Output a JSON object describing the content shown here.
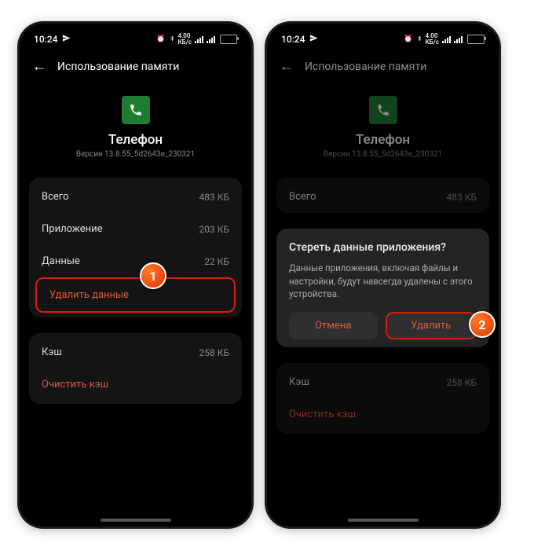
{
  "status": {
    "time": "10:24",
    "net_speed": "4.00",
    "net_unit": "КБ/с"
  },
  "header": {
    "title": "Использование памяти"
  },
  "app": {
    "name": "Телефон",
    "version": "Версия 13.8.55_5d2643e_230321"
  },
  "storage": {
    "total_label": "Всего",
    "total_value": "483 КБ",
    "app_label": "Приложение",
    "app_value": "203 КБ",
    "data_label": "Данные",
    "data_value": "22 КБ",
    "clear_data": "Удалить данные"
  },
  "cache": {
    "label": "Кэш",
    "value": "258 КБ",
    "clear": "Очистить кэш"
  },
  "dialog": {
    "title": "Стереть данные приложения?",
    "body": "Данные приложения, включая файлы и настройки, будут навсегда удалены с этого устройства.",
    "cancel": "Отмена",
    "confirm": "Удалить"
  },
  "steps": {
    "one": "1",
    "two": "2"
  }
}
